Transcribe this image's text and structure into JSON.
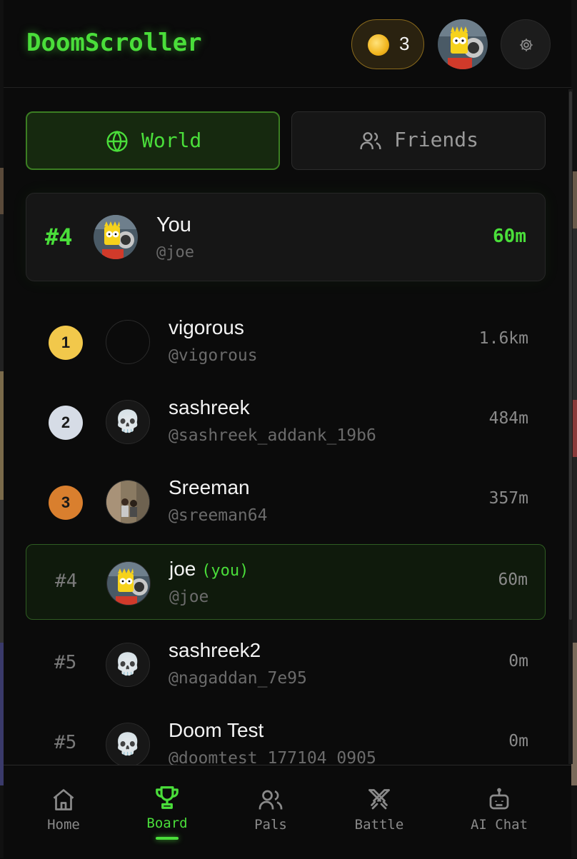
{
  "header": {
    "app_title": "DoomScroller",
    "coin_count": "3"
  },
  "tabs": [
    {
      "label": "World",
      "active": true,
      "icon": "globe-icon"
    },
    {
      "label": "Friends",
      "active": false,
      "icon": "users-icon"
    }
  ],
  "my_rank": {
    "rank": "#4",
    "name": "You",
    "handle": "@joe",
    "distance": "60m"
  },
  "leaderboard": [
    {
      "rank": "1",
      "name": "vigorous",
      "handle": "@vigorous",
      "distance": "1.6km",
      "medal_color": "#f2c84b",
      "avatar": "empty"
    },
    {
      "rank": "2",
      "name": "sashreek",
      "handle": "@sashreek_addank_19b6",
      "distance": "484m",
      "medal_color": "#d6dce6",
      "avatar": "skull"
    },
    {
      "rank": "3",
      "name": "Sreeman",
      "handle": "@sreeman64",
      "distance": "357m",
      "medal_color": "#d97f2e",
      "avatar": "photo"
    },
    {
      "rank": "#4",
      "name": "joe",
      "you_tag": "(you)",
      "handle": "@joe",
      "distance": "60m",
      "avatar": "cartoon"
    },
    {
      "rank": "#5",
      "name": "sashreek2",
      "handle": "@nagaddan_7e95",
      "distance": "0m",
      "avatar": "skull"
    },
    {
      "rank": "#5",
      "name": "Doom Test",
      "handle": "@doomtest_177104_0905",
      "distance": "0m",
      "avatar": "skull"
    }
  ],
  "nav": [
    {
      "label": "Home",
      "icon": "home-icon",
      "active": false
    },
    {
      "label": "Board",
      "icon": "trophy-icon",
      "active": true
    },
    {
      "label": "Pals",
      "icon": "users-icon",
      "active": false
    },
    {
      "label": "Battle",
      "icon": "swords-icon",
      "active": false
    },
    {
      "label": "AI Chat",
      "icon": "bot-icon",
      "active": false
    }
  ],
  "colors": {
    "accent": "#4ade3a",
    "background": "#0b0b0b",
    "gold": "#f2c84b",
    "silver": "#d6dce6",
    "bronze": "#d97f2e"
  }
}
